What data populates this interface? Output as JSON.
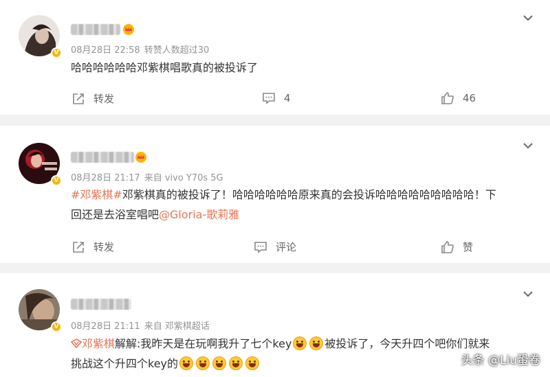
{
  "posts": [
    {
      "time": "08月28日 22:58",
      "source": "转赞人数超过30",
      "text": "哈哈哈哈哈哈邓紫棋唱歌真的被投诉了",
      "actions": {
        "repost": "转发",
        "comment": "4",
        "like": "46"
      }
    },
    {
      "time": "08月28日 21:17",
      "source": "来自 vivo Y70s 5G",
      "hashtag": "#邓紫棋#",
      "line1": "邓紫棋真的被投诉了！哈哈哈哈哈哈原来真的会投诉哈哈哈哈哈哈哈哈哈！下",
      "line2_text": "回还是去浴室唱吧",
      "mention": "@Gloria-歌莉雅",
      "actions": {
        "repost": "转发",
        "comment": "评论",
        "like": "赞"
      }
    },
    {
      "time": "08月28日 21:11",
      "source": "来自 邓紫棋超话",
      "topic": "邓紫棋",
      "line1_a": "解解:我昨天是在玩啊我升了七个key",
      "line1_b": "被投诉了，今天升四个吧你们就来",
      "line2": "挑战这个升四个key的"
    }
  ],
  "watermark": "头条 @Liu蛩卷",
  "colors": {
    "link": "#eb7350",
    "meta": "#939393",
    "badge": "#f7b500"
  }
}
